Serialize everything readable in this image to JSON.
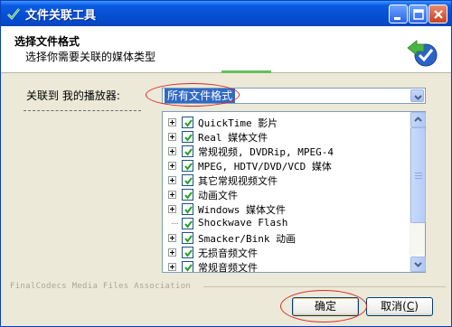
{
  "window": {
    "title": "文件关联工具",
    "header_title": "选择文件格式",
    "header_subtitle": "选择你需要关联的媒体类型"
  },
  "link_label": "关联到 我的播放器:",
  "combo": {
    "selected": "所有文件格式"
  },
  "tree": {
    "items": [
      {
        "label": "QuickTime 影片",
        "checked": true,
        "expandable": true
      },
      {
        "label": "Real 媒体文件",
        "checked": true,
        "expandable": true
      },
      {
        "label": "常规视频, DVDRip, MPEG-4",
        "checked": true,
        "expandable": true
      },
      {
        "label": "MPEG, HDTV/DVD/VCD 媒体",
        "checked": true,
        "expandable": true
      },
      {
        "label": "其它常规视频文件",
        "checked": true,
        "expandable": true
      },
      {
        "label": "动画文件",
        "checked": true,
        "expandable": true
      },
      {
        "label": "Windows 媒体文件",
        "checked": true,
        "expandable": true
      },
      {
        "label": "Shockwave Flash",
        "checked": true,
        "expandable": false
      },
      {
        "label": "Smacker/Bink 动画",
        "checked": true,
        "expandable": true
      },
      {
        "label": "无损音频文件",
        "checked": true,
        "expandable": true
      },
      {
        "label": "常规音频文件",
        "checked": true,
        "expandable": true
      }
    ]
  },
  "footer": {
    "text": "FinalCodecs Media Files Association"
  },
  "buttons": {
    "ok": "确定",
    "cancel_text": "取消",
    "cancel_key": "C"
  }
}
